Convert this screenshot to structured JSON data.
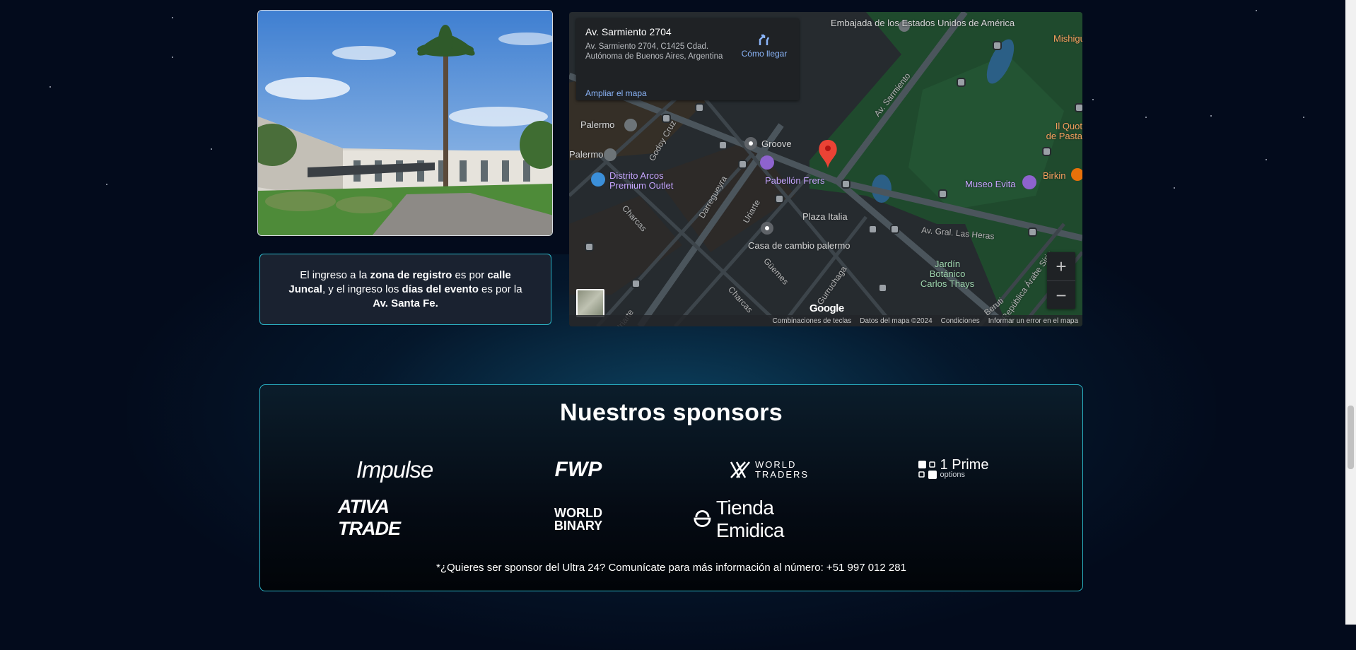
{
  "venue_note": {
    "p1": "El ingreso a la ",
    "b1": "zona de registro",
    "p2": " es por ",
    "b2": "calle Juncal",
    "p3": ", y el ingreso los ",
    "b3": "días del evento",
    "p4": " es por la ",
    "b4": "Av. Santa Fe."
  },
  "map": {
    "card_title": "Av. Sarmiento 2704",
    "card_address": "Av. Sarmiento 2704, C1425 Cdad. Autónoma de Buenos Aires, Argentina",
    "directions_label": "Cómo llegar",
    "enlarge_label": "Ampliar el mapa",
    "zoom_in": "+",
    "zoom_out": "−",
    "google": "Google",
    "labels": {
      "us_embassy": "Embajada de los Estados Unidos de América",
      "mishigue": "Mishigue",
      "palermo1": "Palermo",
      "palermo2": "Palermo",
      "palermo3": "Palermo",
      "groove": "Groove",
      "distrito": "Distrito Arcos Premium Outlet",
      "pabellon": "Pabellón Frers",
      "plaza_italia": "Plaza Italia",
      "casa_cambio": "Casa de cambio palermo",
      "museo_evita": "Museo Evita",
      "birkin": "Birkin",
      "quot": "Il Quot de Pasta",
      "jardin": "Jardín Botánico Carlos Thays",
      "av_sarmiento": "Av. Sarmiento",
      "godoy_cruz": "Godoy Cruz",
      "darregueyra": "Darregueyra",
      "uriarte": "Uriarte",
      "charcas1": "Charcas",
      "charcas2": "Charcas",
      "guemes": "Güemes",
      "gurruchaga": "Gurruchaga",
      "las_heras": "Av. Gral. Las Heras",
      "republica_arabe": "República Árabe Siria",
      "beruti": "Beruti",
      "uriarte2": "Uriarte"
    },
    "attribution": {
      "shortcuts": "Combinaciones de teclas",
      "data": "Datos del mapa ©2024",
      "terms": "Condiciones",
      "report": "Informar un error en el mapa"
    }
  },
  "sponsors": {
    "title": "Nuestros sponsors",
    "logos": {
      "impulse": "Impulse",
      "fwp": "FWP",
      "world_traders_1": "WORLD",
      "world_traders_2": "TRADERS",
      "prime_1": "1 Prime",
      "prime_2": "options",
      "ativa": "ATIVA TRADE",
      "wb_1": "WORLD",
      "wb_2": "BINARY",
      "emidica": "Tienda Emidica"
    },
    "cta": "*¿Quieres ser sponsor del Ultra 24? Comunícate para más información al número: +51 997 012 281"
  },
  "colors": {
    "background": "#030b1c",
    "accent_border": "#2bb7c9",
    "map_link": "#8ab4f8",
    "pin": "#ea4335"
  }
}
